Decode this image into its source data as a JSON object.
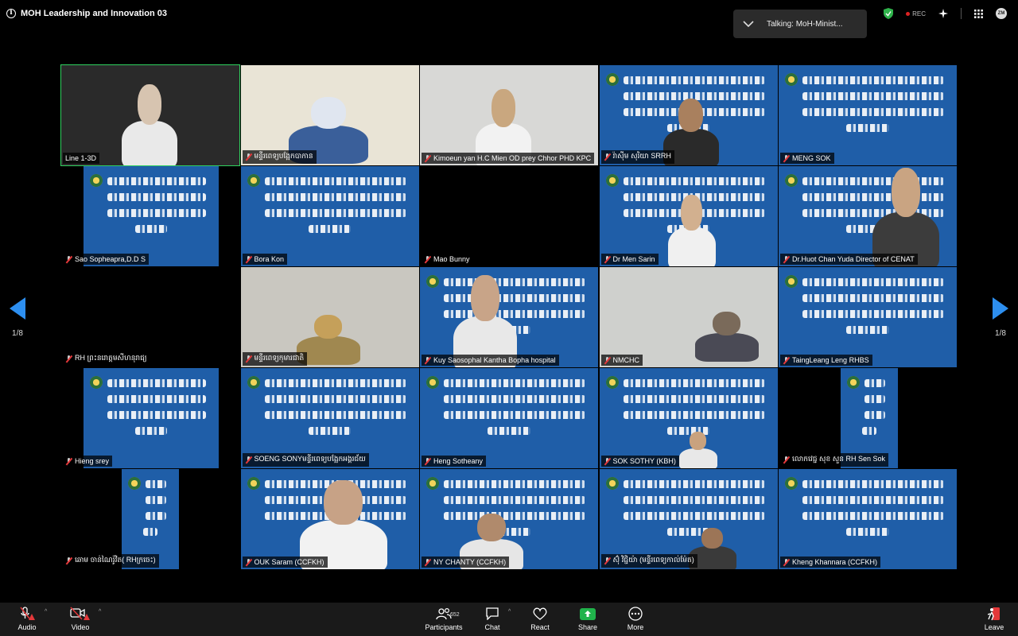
{
  "window": {
    "title": "MOH Leadership and Innovation 03",
    "talking_label": "Talking:",
    "talking_name": "MoH-Minist...",
    "rec_label": "REC",
    "account_initials": "ZM"
  },
  "pager": {
    "left": "1/8",
    "right": "1/8"
  },
  "participants": [
    {
      "name": "Line 1-3D",
      "muted": false
    },
    {
      "name": "មន្ទីរពេទ្យបង្អែកបាកាន",
      "muted": true
    },
    {
      "name": "Kimoeun yan H.C Mien OD prey Chhor PHD KPC",
      "muted": true
    },
    {
      "name": "រ៉ាស៊ីម សុរិយា SRRH",
      "muted": true
    },
    {
      "name": "MENG SOK",
      "muted": true
    },
    {
      "name": "Sao Sopheapra,D.D S",
      "muted": true
    },
    {
      "name": "Bora Kon",
      "muted": true
    },
    {
      "name": "Mao Bunny",
      "muted": true
    },
    {
      "name": "Dr Men Sarin",
      "muted": true
    },
    {
      "name": "Dr.Huot Chan Yuda Director of CENAT",
      "muted": true
    },
    {
      "name": "RH ព្រះនរោត្តមសីហនុរាជ្យ",
      "muted": true
    },
    {
      "name": "មន្ទីរពេទ្យកុមារជាតិ",
      "muted": true
    },
    {
      "name": "Kuy Saosophal Kantha Bopha hospital",
      "muted": true
    },
    {
      "name": "NMCHC",
      "muted": true
    },
    {
      "name": "TaingLeang Leng RHBS",
      "muted": true
    },
    {
      "name": "Hieng srey",
      "muted": true
    },
    {
      "name": "SOENG SONYមន្ទីរពេទ្យបង្អែកអង្គរជ័យ",
      "muted": true
    },
    {
      "name": "Heng Sotheany",
      "muted": true
    },
    {
      "name": "SOK SOTHY (KBH)",
      "muted": true
    },
    {
      "name": "លោកវេជ្ជ សុខ សួន RH Sen Sok",
      "muted": true
    },
    {
      "name": "ឆោម ចាន់ណៃរ៉ូវិត( RHក្រចេះ)",
      "muted": true
    },
    {
      "name": "OUK Saram (CCFKH)",
      "muted": true
    },
    {
      "name": "NY CHANTY (CCFKH)",
      "muted": true
    },
    {
      "name": "ស៊ុំ វិជ្ជិយ៉ា (មន្ទីរពេទ្យកាល់ម៉ែត)",
      "muted": true
    },
    {
      "name": "Kheng Khannara (CCFKH)",
      "muted": true
    }
  ],
  "toolbar": {
    "audio": "Audio",
    "video": "Video",
    "participants": "Participants",
    "participant_count": "652",
    "chat": "Chat",
    "react": "React",
    "share": "Share",
    "more": "More",
    "leave": "Leave"
  },
  "colors": {
    "active_speaker": "#2fd15e",
    "slide_bg": "#1f5ea8",
    "nav_arrow": "#2d8ff0",
    "share": "#20b34b"
  }
}
